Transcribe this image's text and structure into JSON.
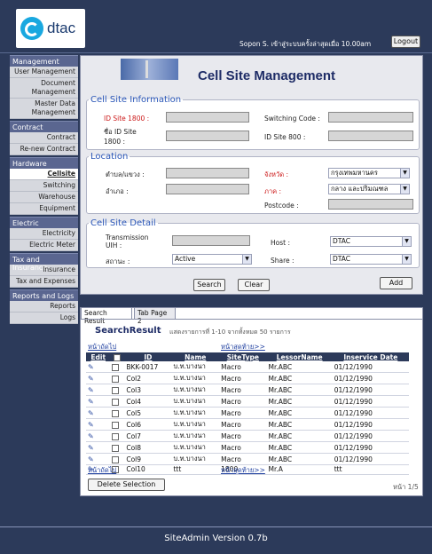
{
  "header": {
    "logo_text": "dtac",
    "user_line": "Sopon S. เข้าสู่ระบบครั้งล่าสุดเมื่อ 10.00am",
    "logout_label": "Logout"
  },
  "sidebar": {
    "sections": [
      {
        "title": "Management",
        "items": [
          "User Management",
          "Document Management",
          "Master Data Management"
        ]
      },
      {
        "title": "Contract",
        "items": [
          "Contract",
          "Re-new Contract"
        ]
      },
      {
        "title": "Hardware",
        "items": [
          "Cellsite",
          "Switching",
          "Warehouse",
          "Equipment"
        ]
      },
      {
        "title": "Electric",
        "items": [
          "Electricity",
          "Electric Meter"
        ]
      },
      {
        "title": "Tax and Insurance",
        "items": [
          "Insurance",
          "Tax and Expenses"
        ]
      },
      {
        "title": "Reports and Logs",
        "items": [
          "Reports",
          "Logs"
        ]
      }
    ]
  },
  "page_title": "Cell Site Management",
  "cell_site_info": {
    "legend": "Cell Site Information",
    "id_site_1800": "ID Site 1800 :",
    "name_id_site_1800": "ชื่อ ID Site 1800 :",
    "switching_code": "Switching Code :",
    "id_site_800": "ID Site 800 :"
  },
  "location": {
    "legend": "Location",
    "subdistrict": "ตำบล/แขวง :",
    "district": "อำเภอ :",
    "province": "จังหวัด :",
    "province_value": "กรุงเทพมหานคร",
    "region": "ภาค :",
    "region_value": "กลาง และปริมณฑล",
    "postcode": "Postcode :"
  },
  "detail": {
    "legend": "Cell Site Detail",
    "transmission": "Transmission UIH :",
    "status": "สถานะ :",
    "status_value": "Active",
    "host": "Host :",
    "host_value": "DTAC",
    "share": "Share :",
    "share_value": "DTAC"
  },
  "buttons": {
    "search": "Search",
    "clear": "Clear",
    "add": "Add",
    "delete": "Delete Selection"
  },
  "results": {
    "tabs": [
      "Search Result",
      "Tab Page 2"
    ],
    "title": "SearchResult",
    "info": "แสดงรายการที่ 1-10 จากทั้งหมด 50 รายการ",
    "prev": "หน้าถัดไป",
    "next": "หน้าสุดท้าย>>",
    "columns": [
      "Edit",
      "",
      "ID",
      "Name",
      "SiteType",
      "LessorName",
      "Inservice Date"
    ],
    "rows": [
      [
        "BKK-0017",
        "บ.ท.บางนา",
        "Macro",
        "Mr.ABC",
        "01/12/1990"
      ],
      [
        "Col2",
        "บ.ท.บางนา",
        "Macro",
        "Mr.ABC",
        "01/12/1990"
      ],
      [
        "Col3",
        "บ.ท.บางนา",
        "Macro",
        "Mr.ABC",
        "01/12/1990"
      ],
      [
        "Col4",
        "บ.ท.บางนา",
        "Macro",
        "Mr.ABC",
        "01/12/1990"
      ],
      [
        "Col5",
        "บ.ท.บางนา",
        "Macro",
        "Mr.ABC",
        "01/12/1990"
      ],
      [
        "Col6",
        "บ.ท.บางนา",
        "Macro",
        "Mr.ABC",
        "01/12/1990"
      ],
      [
        "Col7",
        "บ.ท.บางนา",
        "Macro",
        "Mr.ABC",
        "01/12/1990"
      ],
      [
        "Col8",
        "บ.ท.บางนา",
        "Macro",
        "Mr.ABC",
        "01/12/1990"
      ],
      [
        "Col9",
        "บ.ท.บางนา",
        "Macro",
        "Mr.ABC",
        "01/12/1990"
      ],
      [
        "Col10",
        "ttt",
        "1800",
        "Mr.A",
        "ttt"
      ]
    ],
    "page": "หน้า 1/5"
  },
  "footer": "SiteAdmin Version 0.7b",
  "colors": {
    "navy": "#2c3a5a",
    "accent": "#2b57b8",
    "required": "#cc1a1a"
  }
}
